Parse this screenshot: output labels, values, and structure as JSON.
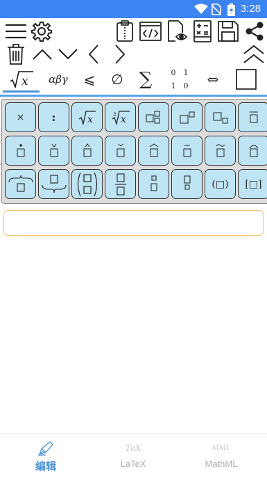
{
  "status_bar": {
    "time": "3:28",
    "icons": [
      "wifi-icon",
      "no-sim-icon",
      "battery-charging-icon"
    ]
  },
  "toolbar": {
    "row1": [
      "menu-icon",
      "settings-icon",
      "clipboard-icon",
      "code-icon",
      "preview-icon",
      "calculator-icon",
      "save-icon",
      "share-icon"
    ],
    "row2": [
      "delete-icon",
      "chevron-up-icon",
      "chevron-down-icon",
      "chevron-left-icon",
      "chevron-right-icon",
      "collapse-icon"
    ]
  },
  "tabs": [
    {
      "label": "√x",
      "name": "tab-radicals"
    },
    {
      "label": "αβγ",
      "name": "tab-greek"
    },
    {
      "label": "⩽",
      "name": "tab-relations"
    },
    {
      "label": "∅",
      "name": "tab-sets"
    },
    {
      "label": "∑",
      "name": "tab-operators"
    },
    {
      "label": "matrix",
      "name": "tab-matrix"
    },
    {
      "label": "⇔",
      "name": "tab-arrows"
    },
    {
      "label": "□",
      "name": "tab-templates"
    }
  ],
  "matrix_tab": {
    "cells": [
      "0",
      "1",
      "1",
      "0"
    ]
  },
  "keys": {
    "row1": [
      "×",
      ":",
      "√x",
      "∛x",
      "stack-script",
      "superscript",
      "subscript",
      "overbar"
    ],
    "row2": [
      "dot-accent",
      "caron-accent",
      "hat-accent",
      "breve-accent",
      "wide-hat",
      "macron",
      "wide-tilde",
      "arc"
    ],
    "row3": [
      "overbrace",
      "underbrace",
      "binomial",
      "fraction",
      "small-stack",
      "tiny-stack",
      "(□)",
      "[□]"
    ]
  },
  "key_text": {
    "times": "×",
    "colon": ":",
    "sqrt_x": "x",
    "cbrt_x": "x",
    "cbrt_index": "3",
    "paren_box": "(□)",
    "bracket_box": "[□]"
  },
  "editor": {
    "value": ""
  },
  "bottom_nav": [
    {
      "label": "编辑",
      "icon": "pen-icon",
      "active": true
    },
    {
      "label": "LaTeX",
      "icon_text": "TeX",
      "active": false
    },
    {
      "label": "MathML",
      "icon_text": "MML",
      "active": false
    }
  ],
  "colors": {
    "accent": "#4a90d9",
    "status_bar": "#3d84f3",
    "key_fill": "#bfe4f4",
    "input_border": "#f2c57a"
  }
}
